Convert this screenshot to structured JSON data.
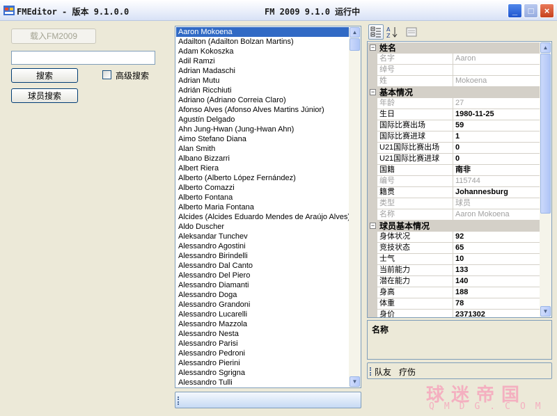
{
  "window": {
    "title_left": "FMEditor - 版本 9.1.0.0",
    "title_center": "FM 2009 9.1.0 运行中"
  },
  "left_panel": {
    "load_button": "载入FM2009",
    "search_value": "",
    "search_button": "搜索",
    "advanced_label": "高级搜索",
    "advanced_checked": false,
    "player_search_button": "球员搜索"
  },
  "player_list": {
    "selected_index": 0,
    "items": [
      "Aaron Mokoena",
      "Adailton (Adailton Bolzan Martins)",
      "Adam Kokoszka",
      "Adil Ramzi",
      "Adrian Madaschi",
      "Adrian Mutu",
      "Adrián Ricchiuti",
      "Adriano (Adriano Correia Claro)",
      "Afonso Alves (Afonso Alves Martins Júnior)",
      "Agustín Delgado",
      "Ahn Jung-Hwan (Jung-Hwan Ahn)",
      "Aimo Stefano Diana",
      "Alan Smith",
      "Albano Bizzarri",
      "Albert Riera",
      "Alberto (Alberto López Fernández)",
      "Alberto Comazzi",
      "Alberto Fontana",
      "Alberto Maria Fontana",
      "Alcides (Alcides Eduardo Mendes de Araújo Alves)",
      "Aldo Duscher",
      "Aleksandar Tunchev",
      "Alessandro Agostini",
      "Alessandro Birindelli",
      "Alessandro Dal Canto",
      "Alessandro Del Piero",
      "Alessandro Diamanti",
      "Alessandro Doga",
      "Alessandro Grandoni",
      "Alessandro Lucarelli",
      "Alessandro Mazzola",
      "Alessandro Nesta",
      "Alessandro Parisi",
      "Alessandro Pedroni",
      "Alessandro Pierini",
      "Alessandro Sgrigna",
      "Alessandro Tulli"
    ]
  },
  "property_grid": {
    "categories": [
      {
        "name": "姓名",
        "rows": [
          {
            "name": "名字",
            "value": "Aaron",
            "readonly": true
          },
          {
            "name": "绰号",
            "value": "",
            "readonly": true
          },
          {
            "name": "姓",
            "value": "Mokoena",
            "readonly": true
          }
        ]
      },
      {
        "name": "基本情况",
        "rows": [
          {
            "name": "年龄",
            "value": "27",
            "readonly": true
          },
          {
            "name": "生日",
            "value": "1980-11-25",
            "readonly": false
          },
          {
            "name": "国际比赛出场",
            "value": "59",
            "readonly": false
          },
          {
            "name": "国际比赛进球",
            "value": "1",
            "readonly": false
          },
          {
            "name": "U21国际比赛出场",
            "value": "0",
            "readonly": false
          },
          {
            "name": "U21国际比赛进球",
            "value": "0",
            "readonly": false
          },
          {
            "name": "国籍",
            "value": "南非",
            "readonly": false
          },
          {
            "name": "编号",
            "value": "115744",
            "readonly": true
          },
          {
            "name": "籍贯",
            "value": "Johannesburg",
            "readonly": false
          },
          {
            "name": "类型",
            "value": "球员",
            "readonly": true
          },
          {
            "name": "名称",
            "value": "Aaron Mokoena",
            "readonly": true
          }
        ]
      },
      {
        "name": "球员基本情况",
        "rows": [
          {
            "name": "身体状况",
            "value": "92",
            "readonly": false
          },
          {
            "name": "竞技状态",
            "value": "65",
            "readonly": false
          },
          {
            "name": "士气",
            "value": "10",
            "readonly": false
          },
          {
            "name": "当前能力",
            "value": "133",
            "readonly": false
          },
          {
            "name": "潜在能力",
            "value": "140",
            "readonly": false
          },
          {
            "name": "身高",
            "value": "188",
            "readonly": false
          },
          {
            "name": "体重",
            "value": "78",
            "readonly": false
          },
          {
            "name": "身价",
            "value": "2371302",
            "readonly": false
          }
        ]
      }
    ],
    "description_title": "名称",
    "commands": [
      "队友",
      "疗伤"
    ]
  },
  "watermark": {
    "cn": "球迷帝国",
    "en": "QMDG.COM"
  },
  "colors": {
    "selection": "#316ac5",
    "window_bg": "#ece9d8",
    "grid_line": "#d4d0c8",
    "watermark": "#f4b0c0"
  }
}
